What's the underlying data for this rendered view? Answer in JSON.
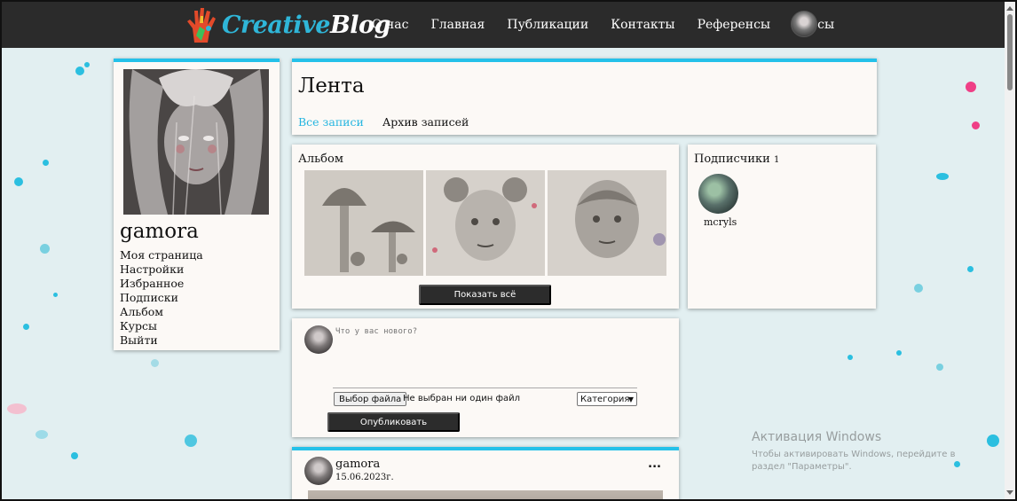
{
  "brand": {
    "logo_part1": "Creative",
    "logo_part2": "Blog",
    "accent": "#24c1e9",
    "nav_bg": "#2b2b2b"
  },
  "nav": {
    "items": [
      "О нас",
      "Главная",
      "Публикации",
      "Контакты",
      "Референсы",
      "Курсы"
    ],
    "avatar_icon": "user-avatar-icon"
  },
  "profile": {
    "username": "gamora",
    "menu": [
      "Моя страница",
      "Настройки",
      "Избранное",
      "Подписки",
      "Альбом",
      "Курсы",
      "Выйти"
    ]
  },
  "feed": {
    "title": "Лента",
    "tabs": [
      "Все записи",
      "Архив записей"
    ],
    "active_tab": "Все записи"
  },
  "album": {
    "title": "Альбом",
    "photos": [
      "mushroom-sketch",
      "girl-portrait-sketch",
      "boy-portrait-sketch"
    ],
    "show_all_label": "Показать всё"
  },
  "subscribers": {
    "title": "Подписчики",
    "count": "1",
    "items": [
      {
        "name": "mcryls"
      }
    ]
  },
  "composer": {
    "placeholder": "Что у вас нового?",
    "file_button": "Выбор файла",
    "file_status": "Не выбран ни один файл",
    "category_label": "Категория",
    "publish_label": "Опубликовать"
  },
  "post": {
    "author": "gamora",
    "date": "15.06.2023г.",
    "menu_label": "..."
  },
  "watermark": {
    "title": "Активация Windows",
    "subtitle": "Чтобы активировать Windows, перейдите в раздел \"Параметры\"."
  }
}
